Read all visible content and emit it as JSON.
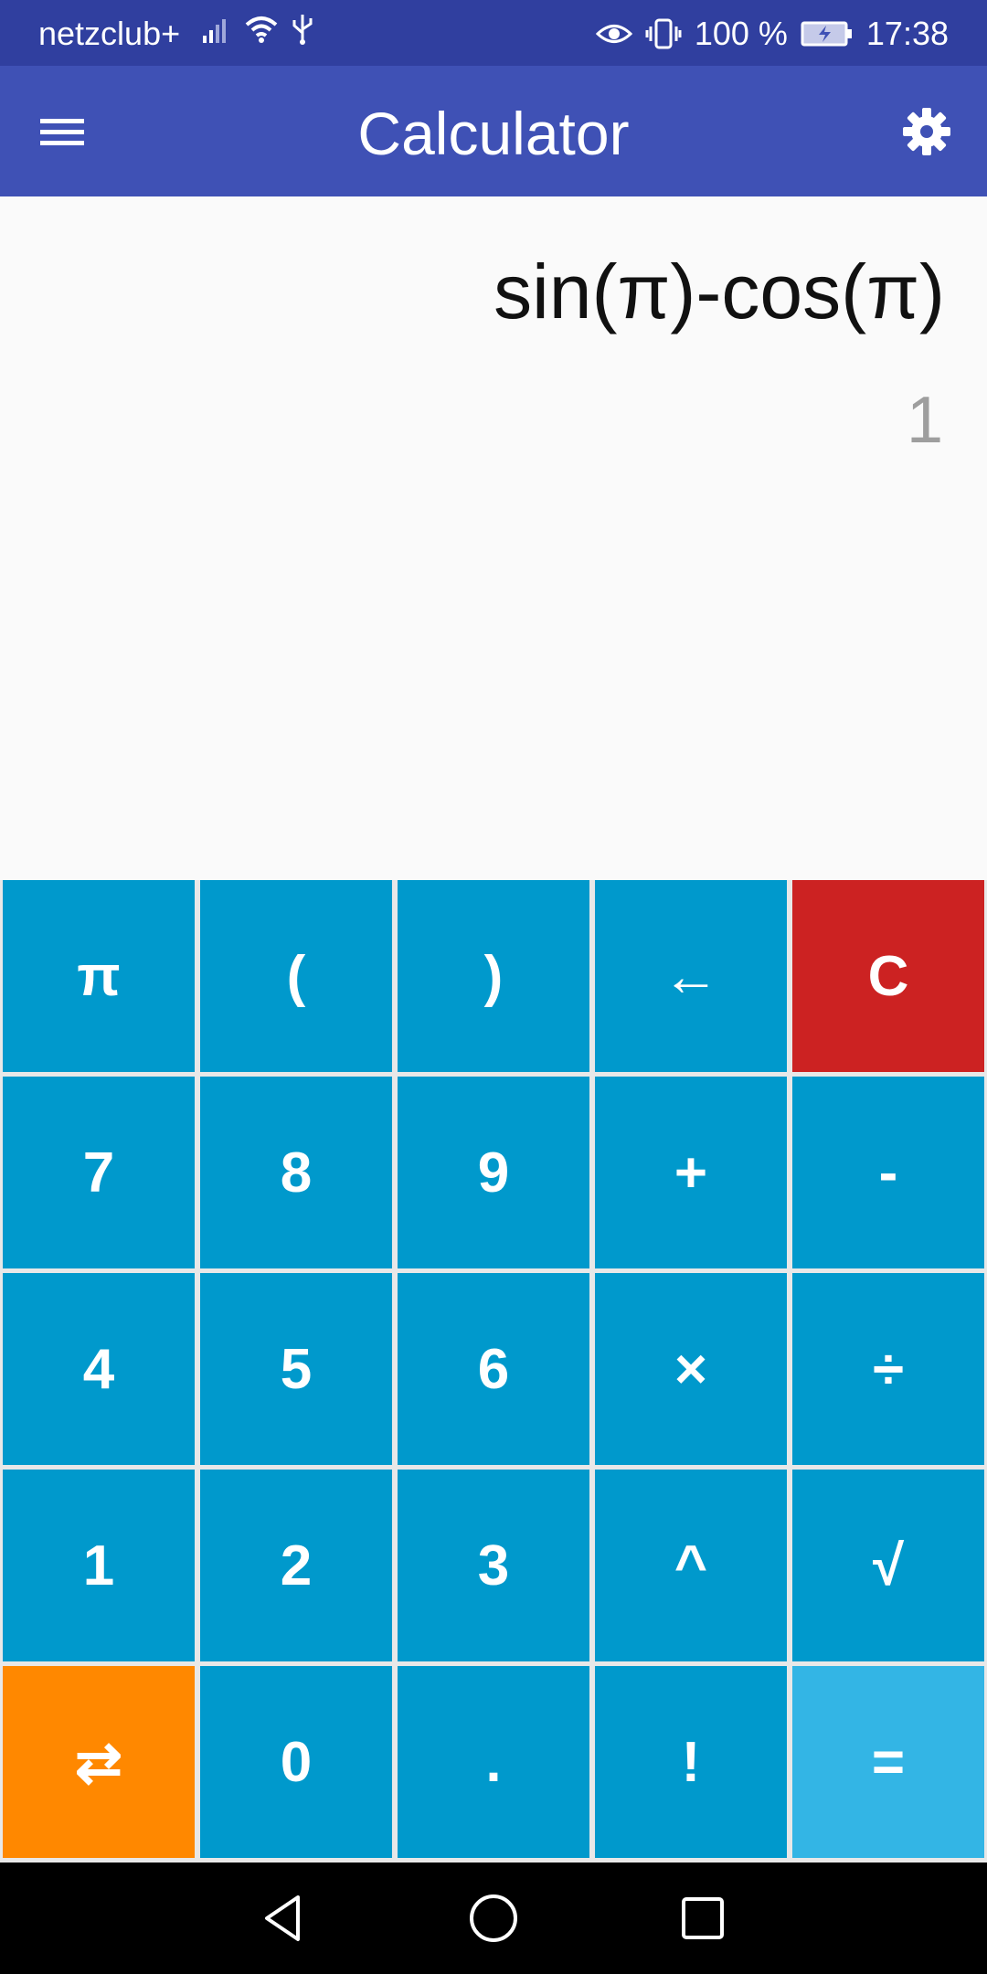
{
  "status_bar": {
    "carrier": "netzclub+",
    "battery": "100 %",
    "time": "17:38"
  },
  "app_bar": {
    "title": "Calculator",
    "menu_icon": "hamburger-menu-icon",
    "settings_icon": "gear-icon"
  },
  "display": {
    "expression": "sin(π)-cos(π)",
    "result": "1"
  },
  "keypad": {
    "rows": [
      [
        "π",
        "(",
        ")",
        "←",
        "C"
      ],
      [
        "7",
        "8",
        "9",
        "+",
        "-"
      ],
      [
        "4",
        "5",
        "6",
        "×",
        "÷"
      ],
      [
        "1",
        "2",
        "3",
        "^",
        "√"
      ],
      [
        "⇄",
        "0",
        ".",
        "!",
        "="
      ]
    ]
  },
  "colors": {
    "status_bar": "#303f9f",
    "app_bar": "#3f51b5",
    "key": "#0099cc",
    "clear_key": "#cc2222",
    "swap_key": "#ff8800",
    "equals_key": "#33b5e5"
  },
  "nav_bar": {
    "icons": [
      "back-triangle-icon",
      "home-circle-icon",
      "recents-square-icon"
    ]
  }
}
